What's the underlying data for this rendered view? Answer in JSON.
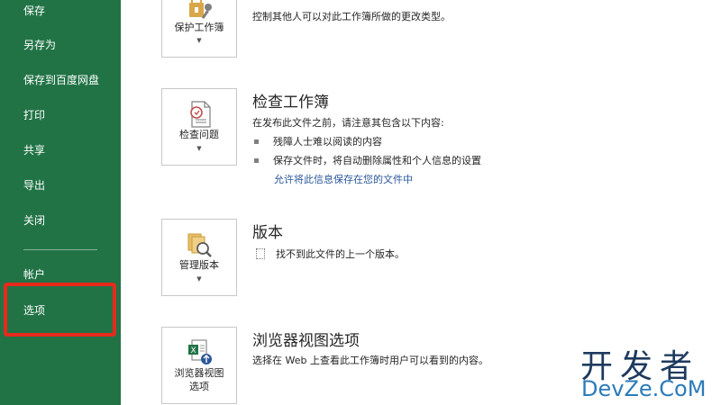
{
  "sidebar": {
    "items": [
      {
        "label": "保存"
      },
      {
        "label": "另存为"
      },
      {
        "label": "保存到百度网盘"
      },
      {
        "label": "打印"
      },
      {
        "label": "共享"
      },
      {
        "label": "导出"
      },
      {
        "label": "关闭"
      },
      {
        "label": "帐户"
      },
      {
        "label": "选项"
      }
    ],
    "highlight_color": "#e8291c",
    "background": "#217346"
  },
  "sections": {
    "protect": {
      "button_label": "保护工作簿",
      "description": "控制其他人可以对此工作簿所做的更改类型。"
    },
    "inspect": {
      "button_label": "检查问题",
      "title": "检查工作簿",
      "description": "在发布此文件之前，请注意其包含以下内容:",
      "bullets": [
        "残障人士难以阅读的内容",
        "保存文件时，将自动删除属性和个人信息的设置"
      ],
      "link": "允许将此信息保存在您的文件中"
    },
    "versions": {
      "button_label": "管理版本",
      "title": "版本",
      "description": "找不到此文件的上一个版本。"
    },
    "browser": {
      "button_label_line1": "浏览器视图",
      "button_label_line2": "选项",
      "title": "浏览器视图选项",
      "description": "选择在 Web 上查看此工作簿时用户可以看到的内容。"
    }
  },
  "watermark": {
    "cn": "开发者",
    "en": "DevZe.CoM"
  },
  "icons": {
    "protect": "lock-key-icon",
    "inspect": "inspect-document-icon",
    "versions": "manage-versions-icon",
    "browser": "browser-view-icon"
  }
}
